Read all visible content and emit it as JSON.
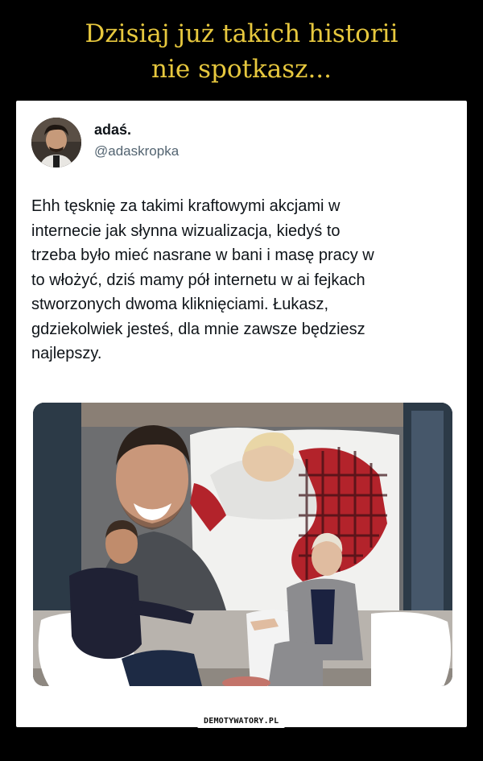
{
  "meme": {
    "title_line1": "Dzisiaj już takich historii",
    "title_line2": "nie spotkasz..."
  },
  "tweet": {
    "display_name": "adaś.",
    "handle": "@adaskropka",
    "lines": [
      "Ehh tęsknię za takimi kraftowymi akcjami w",
      "internecie jak słynna wizualizacja, kiedyś to",
      "trzeba było mieć nasrane w bani i masę pracy w",
      "to włożyć, dziś mamy pół internetu w ai fejkach",
      "stworzonych dwoma kliknięciami. Łukasz,",
      "gdziekolwiek jesteś, dla mnie zawsze będziesz",
      "najlepszy."
    ]
  },
  "watermark": "DEMOTYWATORY.PL",
  "colors": {
    "title": "#e7c83e",
    "background": "#000000",
    "card": "#ffffff",
    "text": "#0f1419",
    "handle": "#536471"
  }
}
